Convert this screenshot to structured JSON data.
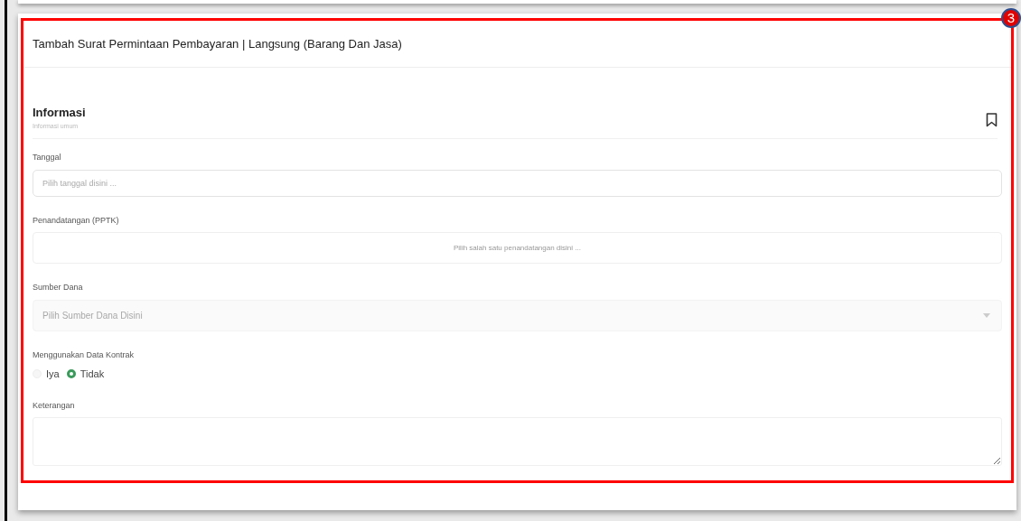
{
  "callout": {
    "number": "3"
  },
  "card": {
    "title": "Tambah Surat Permintaan Pembayaran | Langsung (Barang Dan Jasa)"
  },
  "section": {
    "title": "Informasi",
    "subtitle": "Informasi umum"
  },
  "fields": [
    {
      "kind": "input",
      "label": "Tanggal",
      "placeholder": "Pilih tanggal disini ..."
    },
    {
      "kind": "select",
      "label": "Penandatangan (PPTK)",
      "placeholder": "Pilih salah satu penandatangan disini ...",
      "disabled": false
    },
    {
      "kind": "select",
      "label": "Sumber Dana",
      "placeholder": "Pilih Sumber Dana Disini",
      "disabled": true
    },
    {
      "kind": "radio",
      "label": "Menggunakan Data Kontrak",
      "options": [
        {
          "label": "Iya",
          "selected": false
        },
        {
          "label": "Tidak",
          "selected": true
        }
      ]
    },
    {
      "kind": "textarea",
      "label": "Keterangan"
    }
  ]
}
